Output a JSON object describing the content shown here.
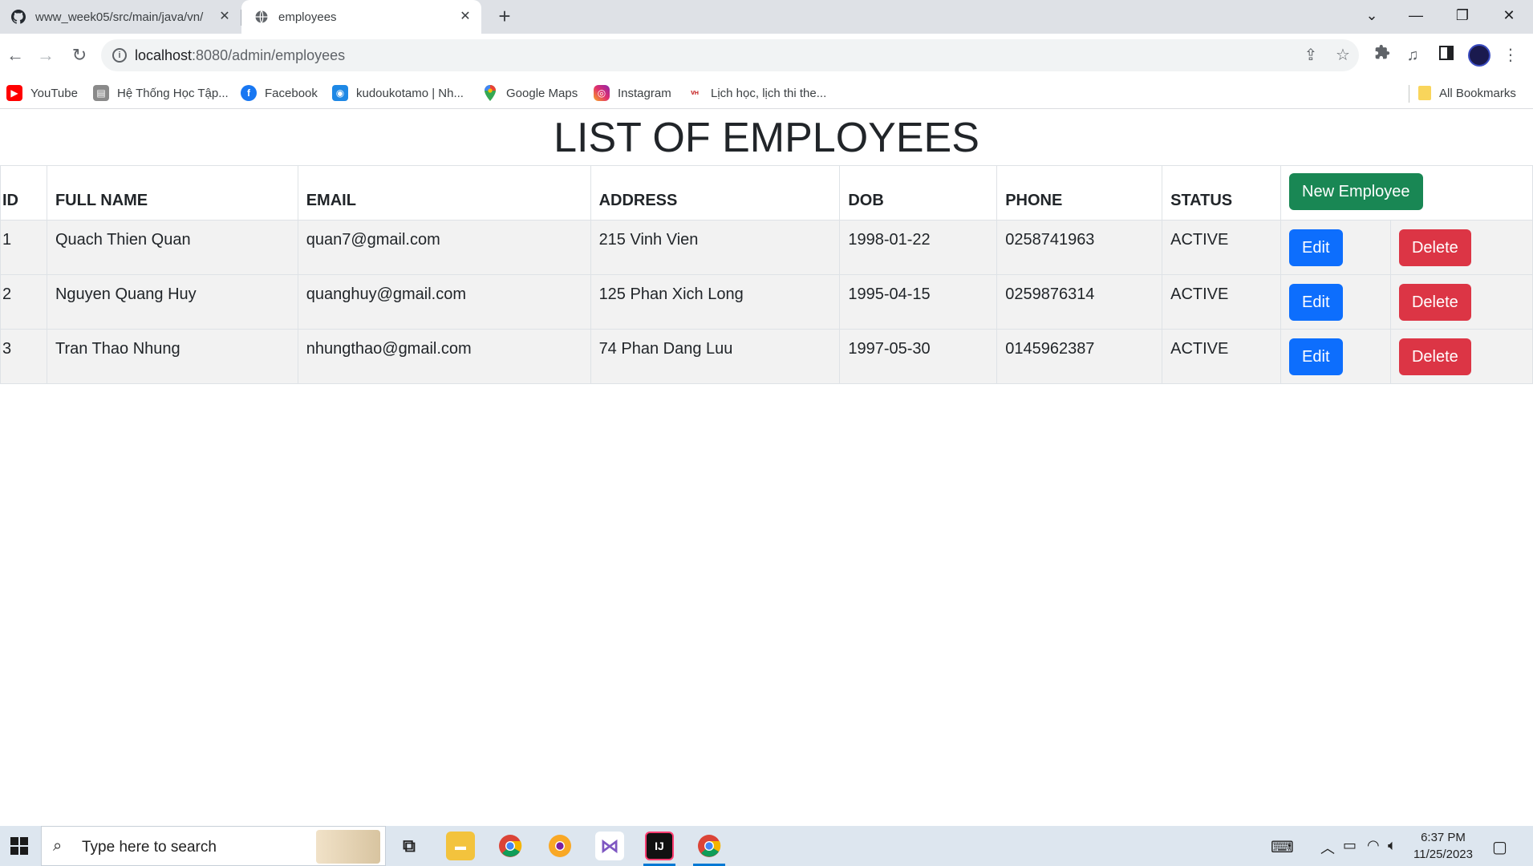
{
  "browser": {
    "tabs": [
      {
        "title": "www_week05/src/main/java/vn/",
        "icon": "github-icon",
        "active": false
      },
      {
        "title": "employees",
        "icon": "globe-icon",
        "active": true
      }
    ],
    "url_host": "localhost",
    "url_rest": ":8080/admin/employees",
    "bookmarks": [
      {
        "label": "YouTube",
        "icon": "youtube-icon",
        "color": "#ff0000"
      },
      {
        "label": "Hệ Thống Học Tập...",
        "icon": "school-icon",
        "color": "#8a8a8a"
      },
      {
        "label": "Facebook",
        "icon": "facebook-icon",
        "color": "#1877f2"
      },
      {
        "label": "kudoukotamo | Nh...",
        "icon": "eye-icon",
        "color": "#1e88e5"
      },
      {
        "label": "Google Maps",
        "icon": "map-pin-icon",
        "color": "#34a853"
      },
      {
        "label": "Instagram",
        "icon": "instagram-icon",
        "color": "#e1306c"
      },
      {
        "label": "Lịch học, lịch thi the...",
        "icon": "calendar-icon",
        "color": "#c62828"
      }
    ],
    "all_bookmarks": "All Bookmarks"
  },
  "page": {
    "title": "LIST OF EMPLOYEES",
    "columns": [
      "ID",
      "FULL NAME",
      "EMAIL",
      "ADDRESS",
      "DOB",
      "PHONE",
      "STATUS"
    ],
    "new_button": "New Employee",
    "edit_label": "Edit",
    "delete_label": "Delete",
    "rows": [
      {
        "id": "1",
        "name": "Quach Thien Quan",
        "email": "quan7@gmail.com",
        "address": "215 Vinh Vien",
        "dob": "1998-01-22",
        "phone": "0258741963",
        "status": "ACTIVE"
      },
      {
        "id": "2",
        "name": "Nguyen Quang Huy",
        "email": "quanghuy@gmail.com",
        "address": "125 Phan Xich Long",
        "dob": "1995-04-15",
        "phone": "0259876314",
        "status": "ACTIVE"
      },
      {
        "id": "3",
        "name": "Tran Thao Nhung",
        "email": "nhungthao@gmail.com",
        "address": "74 Phan Dang Luu",
        "dob": "1997-05-30",
        "phone": "0145962387",
        "status": "ACTIVE"
      }
    ]
  },
  "taskbar": {
    "search_placeholder": "Type here to search",
    "time": "6:37 PM",
    "date": "11/25/2023"
  },
  "colors": {
    "new_button": "#198754",
    "edit_button": "#0d6efd",
    "delete_button": "#dc3545",
    "row_background": "#f2f2f2"
  }
}
